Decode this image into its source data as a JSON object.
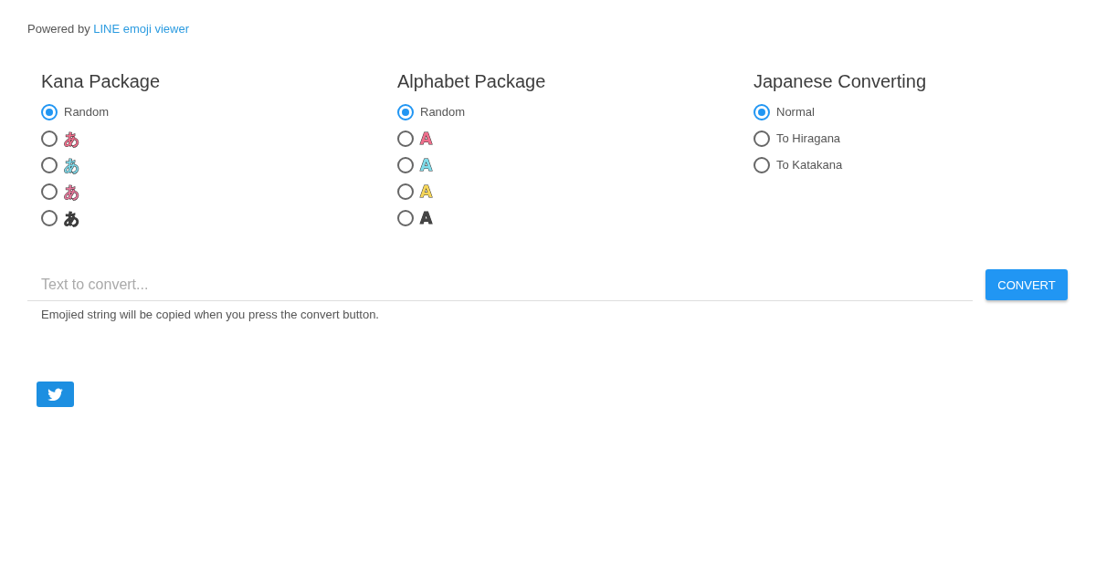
{
  "attribution": {
    "text": "Powered by",
    "link": "LINE emoji viewer"
  },
  "groups": [
    {
      "title": "Kana Package",
      "options": [
        {
          "kind": "text",
          "label": "Random",
          "selected": true
        },
        {
          "kind": "emoji",
          "label": "あ",
          "color": "#ef6f8c",
          "selected": false
        },
        {
          "kind": "emoji",
          "label": "あ",
          "color": "#7fd8e8",
          "selected": false
        },
        {
          "kind": "emoji",
          "label": "あ",
          "color": "#e7789c",
          "selected": false
        },
        {
          "kind": "emoji",
          "label": "あ",
          "color": "#3f3f3f",
          "selected": false
        }
      ]
    },
    {
      "title": "Alphabet Package",
      "options": [
        {
          "kind": "text",
          "label": "Random",
          "selected": true
        },
        {
          "kind": "emoji",
          "label": "A",
          "color": "#ef6f8c",
          "selected": false
        },
        {
          "kind": "emoji",
          "label": "A",
          "color": "#7fdcea",
          "selected": false
        },
        {
          "kind": "emoji",
          "label": "A",
          "color": "#f6d65a",
          "selected": false
        },
        {
          "kind": "emoji",
          "label": "A",
          "color": "#444444",
          "selected": false
        }
      ]
    },
    {
      "title": "Japanese Converting",
      "options": [
        {
          "kind": "text",
          "label": "Normal",
          "selected": true
        },
        {
          "kind": "text",
          "label": "To Hiragana",
          "selected": false
        },
        {
          "kind": "text",
          "label": "To Katakana",
          "selected": false
        }
      ]
    }
  ],
  "converter": {
    "placeholder": "Text to convert...",
    "button": "CONVERT",
    "hint": "Emojied string will be copied when you press the convert button."
  }
}
